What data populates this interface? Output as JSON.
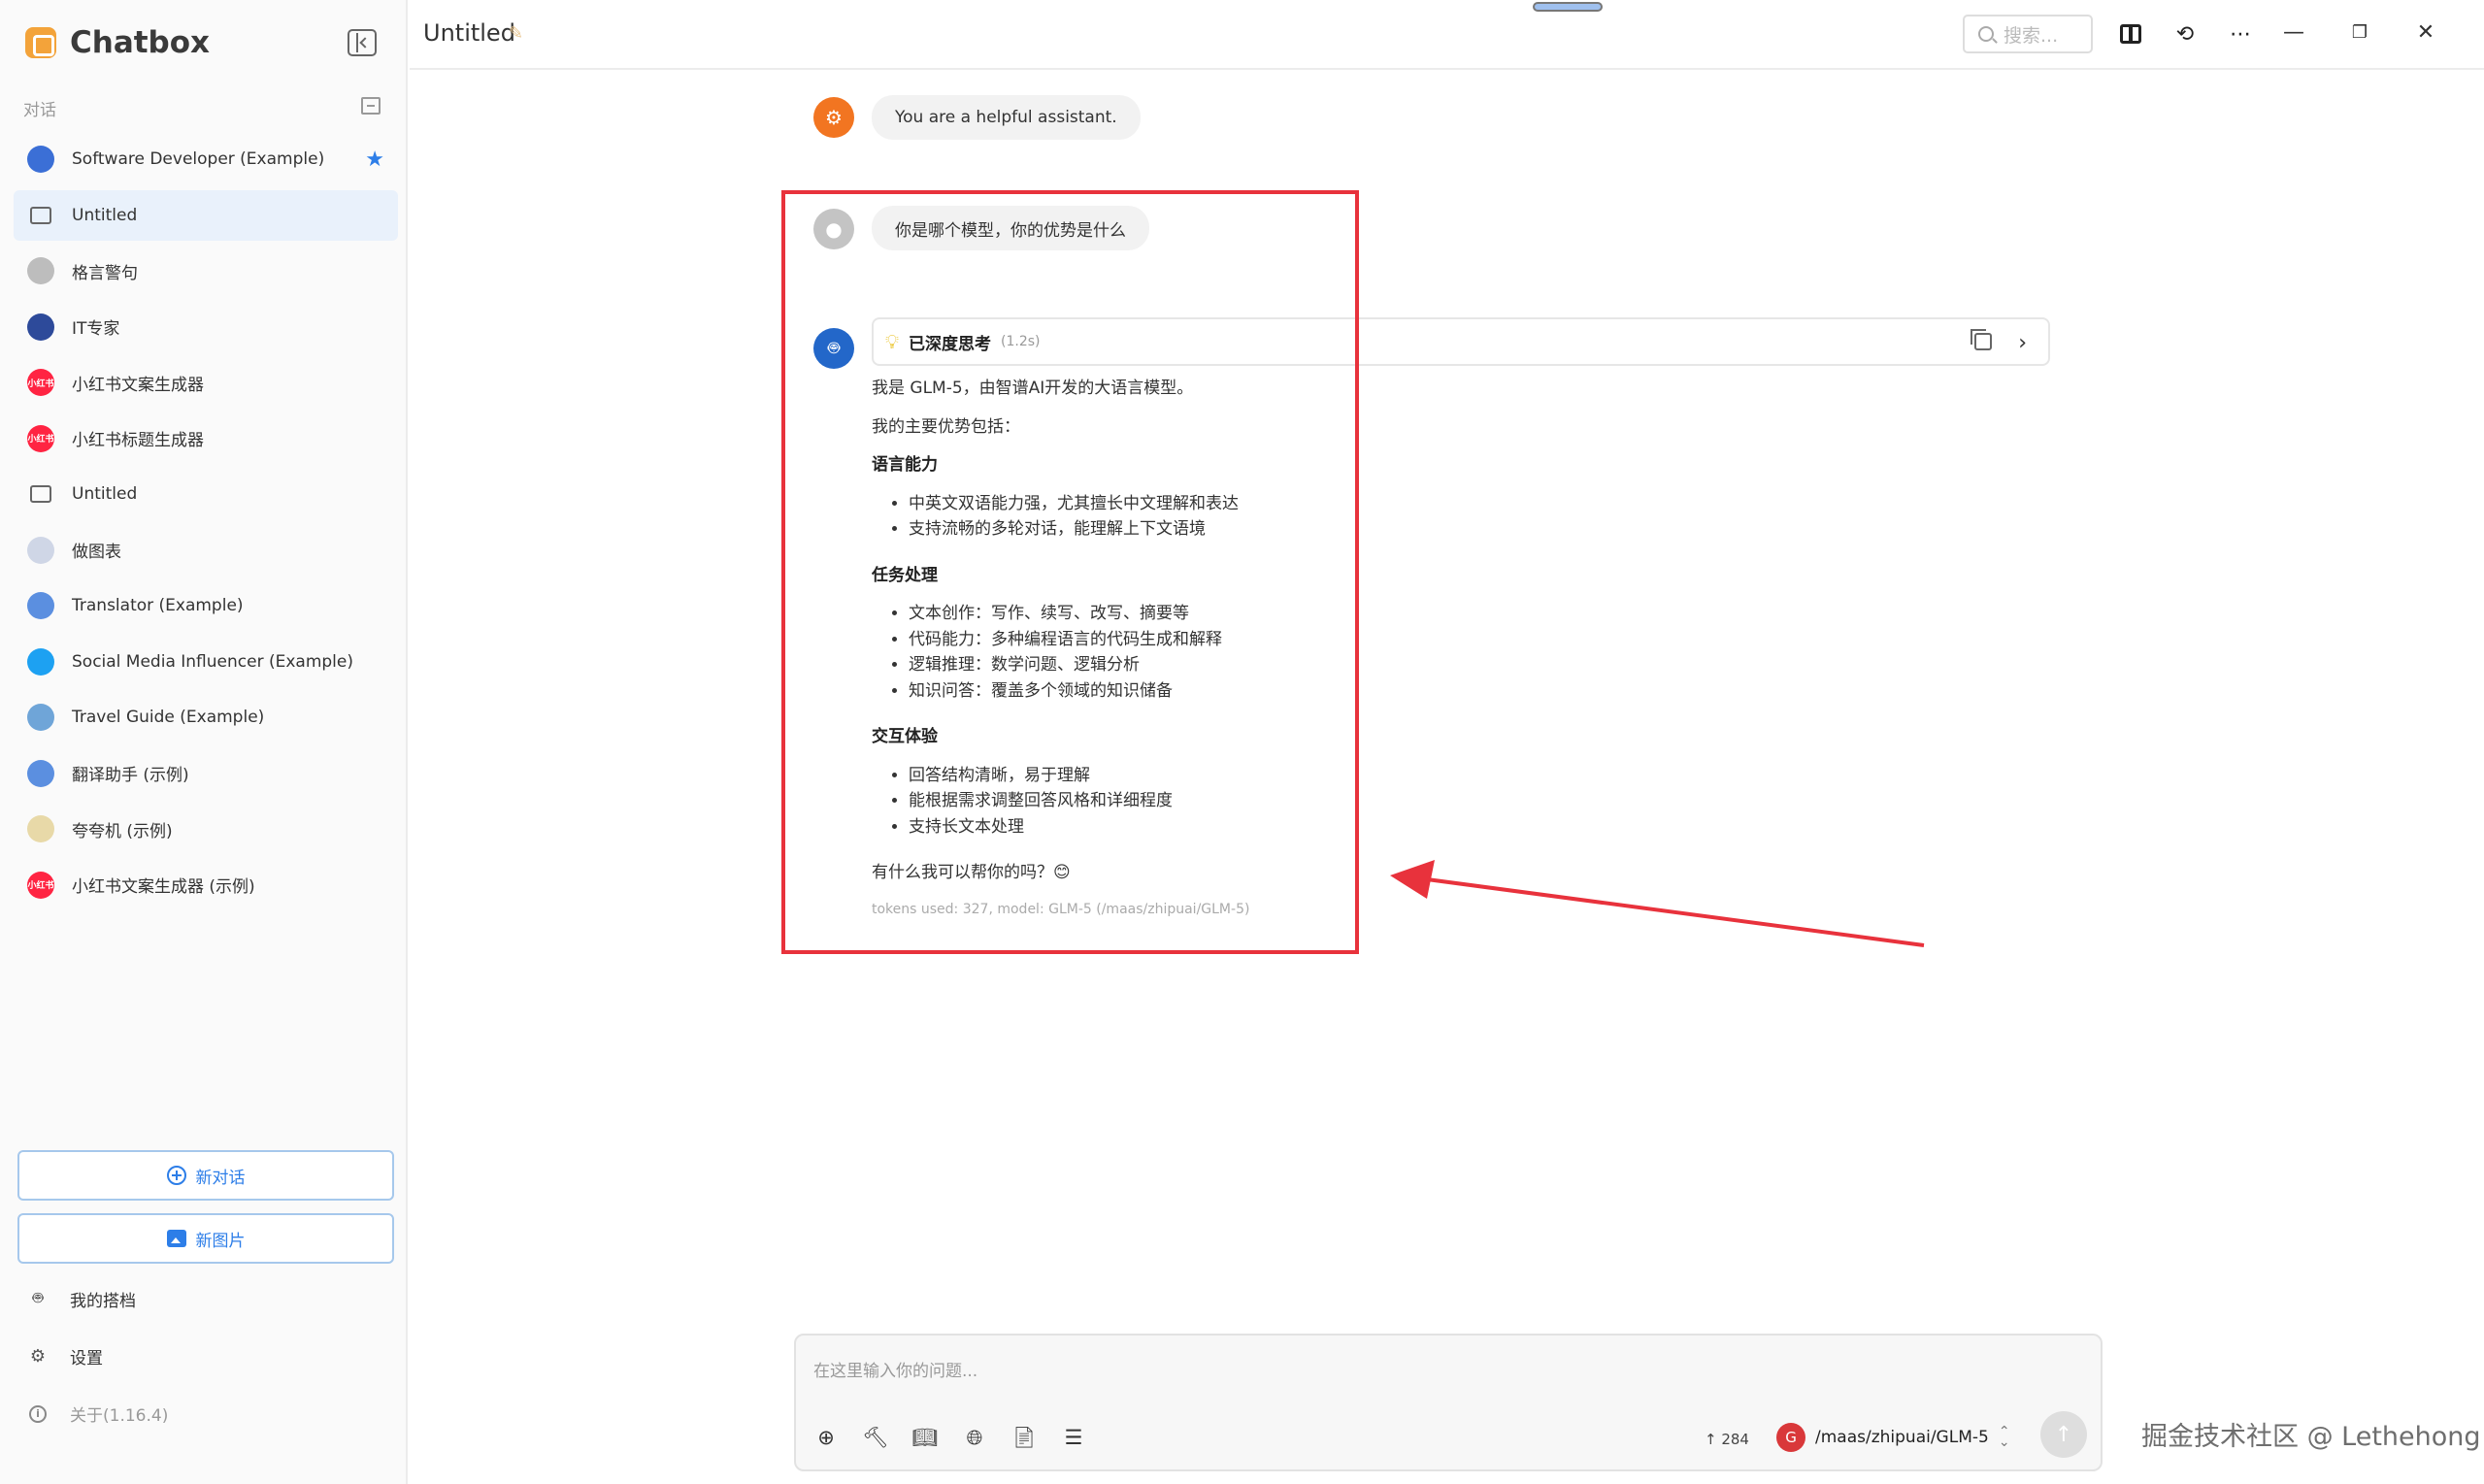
{
  "app": {
    "name": "Chatbox"
  },
  "sidebar": {
    "section_label": "对话",
    "conversations": [
      {
        "label": "Software Developer (Example)",
        "icon": "developer-avatar-icon",
        "color": "#3b6fd6",
        "starred": true
      },
      {
        "label": "Untitled",
        "icon": "chat-bubble-icon",
        "active": true
      },
      {
        "label": "格言警句",
        "icon": "user-avatar-icon",
        "color": "#bdbdbd"
      },
      {
        "label": "IT专家",
        "icon": "it-expert-avatar-icon",
        "color": "#2d4a9a"
      },
      {
        "label": "小红书文案生成器",
        "icon": "xiaohongshu-avatar-icon",
        "color": "#ff2442",
        "badge": "小红书"
      },
      {
        "label": "小红书标题生成器",
        "icon": "xiaohongshu-avatar-icon",
        "color": "#ff2442",
        "badge": "小红书"
      },
      {
        "label": "Untitled",
        "icon": "chat-bubble-icon"
      },
      {
        "label": "做图表",
        "icon": "chart-avatar-icon",
        "color": "#cfd6e6"
      },
      {
        "label": "Translator (Example)",
        "icon": "translator-avatar-icon",
        "color": "#5b8fe0"
      },
      {
        "label": "Social Media Influencer (Example)",
        "icon": "twitter-avatar-icon",
        "color": "#1da1f2"
      },
      {
        "label": "Travel Guide (Example)",
        "icon": "travel-avatar-icon",
        "color": "#6fa5d8"
      },
      {
        "label": "翻译助手 (示例)",
        "icon": "translator-avatar-icon",
        "color": "#5b8fe0"
      },
      {
        "label": "夸夸机 (示例)",
        "icon": "praise-avatar-icon",
        "color": "#e8d9a8"
      },
      {
        "label": "小红书文案生成器 (示例)",
        "icon": "xiaohongshu-avatar-icon",
        "color": "#ff2442",
        "badge": "小红书"
      }
    ],
    "new_chat_label": "新对话",
    "new_image_label": "新图片",
    "my_partners_label": "我的搭档",
    "settings_label": "设置",
    "about_label": "关于(1.16.4)"
  },
  "header": {
    "title": "Untitled",
    "search_placeholder": "搜索..."
  },
  "chat": {
    "system_message": "You are a helpful assistant.",
    "user_message": "你是哪个模型，你的优势是什么",
    "thinking_label": "已深度思考",
    "thinking_time": "(1.2s)",
    "answer": {
      "intro": "我是 GLM-5，由智谱AI开发的大语言模型。",
      "advantages_intro": "我的主要优势包括：",
      "sections": [
        {
          "heading": "语言能力",
          "items": [
            "中英文双语能力强，尤其擅长中文理解和表达",
            "支持流畅的多轮对话，能理解上下文语境"
          ]
        },
        {
          "heading": "任务处理",
          "items": [
            "文本创作：写作、续写、改写、摘要等",
            "代码能力：多种编程语言的代码生成和解释",
            "逻辑推理：数学问题、逻辑分析",
            "知识问答：覆盖多个领域的知识储备"
          ]
        },
        {
          "heading": "交互体验",
          "items": [
            "回答结构清晰，易于理解",
            "能根据需求调整回答风格和详细程度",
            "支持长文本处理"
          ]
        }
      ],
      "closing": "有什么我可以帮你的吗？😊",
      "tokens_info": "tokens used: 327, model: GLM-5 (/maas/zhipuai/GLM-5)"
    }
  },
  "input": {
    "placeholder": "在这里输入你的问题...",
    "token_count": "↑ 284",
    "model_badge": "G",
    "model_name": "/maas/zhipuai/GLM-5"
  },
  "watermark": "掘金技术社区 @ Lethehong",
  "colors": {
    "accent": "#2d7ee8",
    "annotation_red": "#e8323c",
    "bot": "#2367c9",
    "system": "#f27521"
  }
}
